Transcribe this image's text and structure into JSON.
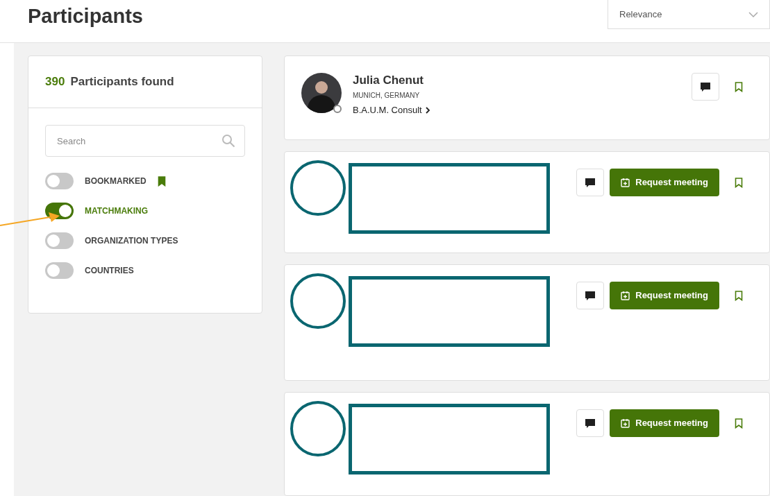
{
  "title": "Participants",
  "sort": {
    "value": "Relevance"
  },
  "filters": {
    "count": "390",
    "count_label": "Participants found",
    "search": {
      "placeholder": "Search"
    },
    "toggles": [
      {
        "label": "BOOKMARKED",
        "on": false,
        "kind": "bookmark"
      },
      {
        "label": "MATCHMAKING",
        "on": true,
        "kind": "plain"
      },
      {
        "label": "ORGANIZATION TYPES",
        "on": false,
        "kind": "plain"
      },
      {
        "label": "COUNTRIES",
        "on": false,
        "kind": "plain"
      }
    ]
  },
  "participants": [
    {
      "kind": "profile",
      "name": "Julia Chenut",
      "location": "MUNICH, GERMANY",
      "organization": "B.A.U.M. Consult"
    },
    {
      "kind": "redacted",
      "request": "Request meeting"
    },
    {
      "kind": "redacted",
      "request": "Request meeting"
    },
    {
      "kind": "redacted",
      "request": "Request meeting"
    }
  ]
}
